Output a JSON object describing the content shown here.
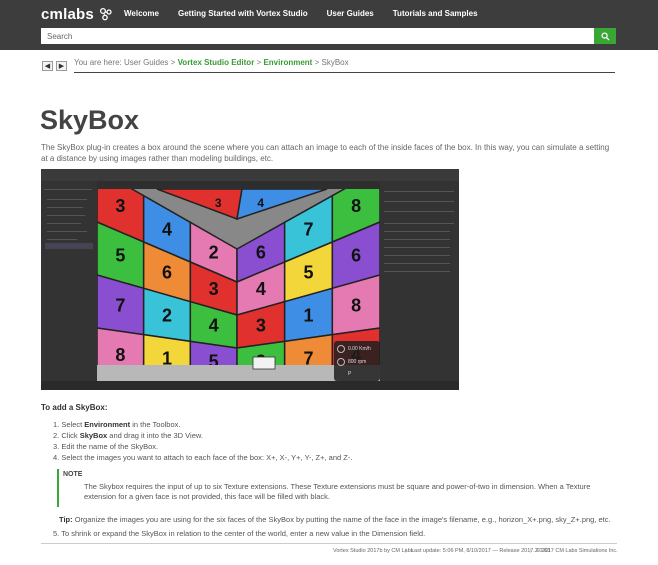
{
  "brand": {
    "logo_text": "cmlabs"
  },
  "nav": {
    "items": [
      "Welcome",
      "Getting Started with Vortex Studio",
      "User Guides",
      "Tutorials and Samples"
    ]
  },
  "search": {
    "placeholder": "Search"
  },
  "breadcrumb": {
    "prefix": "You are here: User Guides >",
    "links": [
      "Vortex Studio Editor",
      "Environment"
    ],
    "separator": ">",
    "current": "SkyBox"
  },
  "page": {
    "title": "SkyBox",
    "intro": "The SkyBox plug-in creates a box around the scene where you can attach an image to each of the inside faces of the box. In this way, you can simulate a setting at a distance by using images rather than modeling buildings, etc."
  },
  "screenshot": {
    "hud_speed": "0.00 Km/h",
    "hud_rpm": "800 rpm",
    "hud_gear": "P",
    "face_numbers": [
      "3",
      "4",
      "2",
      "5",
      "6",
      "3",
      "7",
      "2",
      "4",
      "8",
      "1",
      "5",
      "6",
      "7",
      "8",
      "4",
      "5",
      "6",
      "3",
      "1",
      "8",
      "2",
      "7",
      "4"
    ],
    "colors": {
      "red": "#e0312f",
      "yellow": "#f3d63a",
      "green": "#3cbf3f",
      "blue": "#3e8ee6",
      "purple": "#8a4fd0",
      "orange": "#ef8a37",
      "pink": "#e57ab3",
      "cyan": "#39c3d8"
    }
  },
  "content": {
    "section_heading": "To add a SkyBox:",
    "steps": [
      {
        "num": "1.",
        "pre": "Select ",
        "bold": "Environment",
        "post": " in the Toolbox."
      },
      {
        "num": "2.",
        "pre": "Click ",
        "bold": "SkyBox",
        "post": " and drag it into the 3D View."
      },
      {
        "num": "3.",
        "pre": "Edit the name of the SkyBox.",
        "bold": "",
        "post": ""
      },
      {
        "num": "4.",
        "pre": "Select the images you want to attach to each face of the box: X+, X-, Y+, Y-, Z+, and Z-.",
        "bold": "",
        "post": ""
      }
    ],
    "note_label": "NOTE",
    "note_text": "The Skybox requires the input of up to six Texture extensions. These Texture extensions must be square and power-of-two in dimension. When a Texture extension for a given face is not provided, this face will be filled with black.",
    "tip_label": "Tip:",
    "tip_text": " Organize the images you are using for the six faces of the SkyBox by putting the name of the face in the image's filename, e.g., horizon_X+.png, sky_Z+.png, etc.",
    "step5": {
      "num": "5.",
      "text": "To shrink or expand the SkyBox in relation to the center of the world, enter a new value in the Dimension field."
    }
  },
  "footer": {
    "product": "Vortex Studio 2017b by CM Labs",
    "updated": "Last update: 5:06 PM, 8/10/2017 — Release 2017.2.0.63",
    "copyright": "© 2017 CM Labs Simulations Inc."
  },
  "theme": {
    "topbar": "#3d3d3d",
    "accent": "#3aa635",
    "title": "#444444"
  }
}
